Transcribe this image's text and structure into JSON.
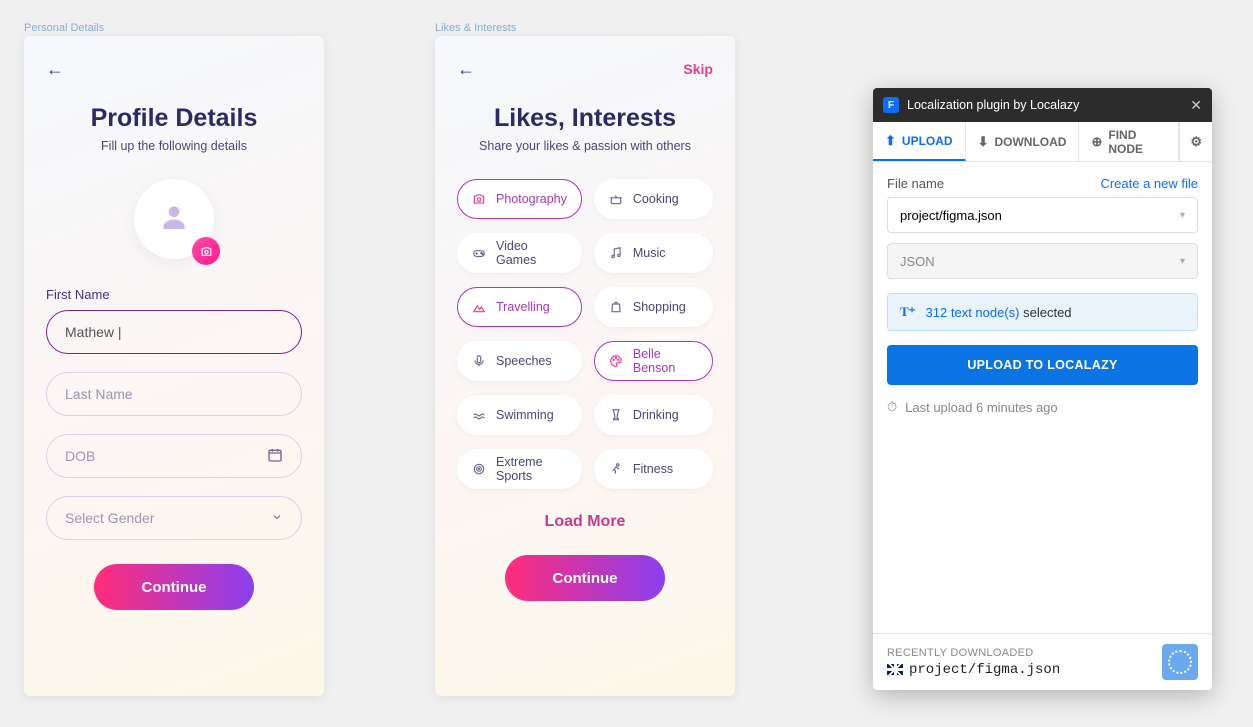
{
  "frames": {
    "personal_details": {
      "label": "Personal Details",
      "title": "Profile Details",
      "subtitle": "Fill up the following details",
      "fields": {
        "first_name_label": "First Name",
        "first_name_value": "Mathew |",
        "last_name_placeholder": "Last Name",
        "dob_placeholder": "DOB",
        "gender_placeholder": "Select Gender"
      },
      "continue": "Continue"
    },
    "likes_interests": {
      "label": "Likes & Interests",
      "skip": "Skip",
      "title": "Likes, Interests",
      "subtitle": "Share your likes & passion with others",
      "chips": [
        {
          "label": "Photography",
          "selected": true,
          "icon": "camera-icon"
        },
        {
          "label": "Cooking",
          "selected": false,
          "icon": "pot-icon"
        },
        {
          "label": "Video Games",
          "selected": false,
          "icon": "gamepad-icon"
        },
        {
          "label": "Music",
          "selected": false,
          "icon": "music-icon"
        },
        {
          "label": "Travelling",
          "selected": true,
          "icon": "mountain-icon"
        },
        {
          "label": "Shopping",
          "selected": false,
          "icon": "bag-icon"
        },
        {
          "label": "Speeches",
          "selected": false,
          "icon": "mic-icon"
        },
        {
          "label": "Belle Benson",
          "selected": true,
          "icon": "palette-icon"
        },
        {
          "label": "Swimming",
          "selected": false,
          "icon": "wave-icon"
        },
        {
          "label": "Drinking",
          "selected": false,
          "icon": "glass-icon"
        },
        {
          "label": "Extreme Sports",
          "selected": false,
          "icon": "target-icon"
        },
        {
          "label": "Fitness",
          "selected": false,
          "icon": "run-icon"
        }
      ],
      "load_more": "Load More",
      "continue": "Continue"
    }
  },
  "plugin": {
    "title": "Localization plugin by Localazy",
    "tabs": {
      "upload": "UPLOAD",
      "download": "DOWNLOAD",
      "find_node": "FIND NODE"
    },
    "file_name_label": "File name",
    "create_new_file": "Create a new file",
    "file_value": "project/figma.json",
    "format_value": "JSON",
    "selected_prefix": "312 text node(s)",
    "selected_suffix": " selected",
    "upload_button": "UPLOAD TO LOCALAZY",
    "last_upload": "Last upload 6 minutes ago",
    "footer_label": "RECENTLY DOWNLOADED",
    "footer_file": "project/figma.json"
  }
}
